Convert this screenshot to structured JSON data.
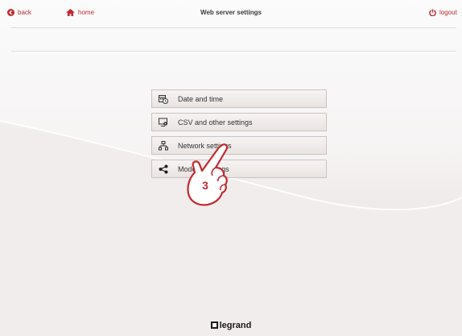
{
  "nav": {
    "back_label": "back",
    "home_label": "home",
    "title": "Web server settings",
    "logout_label": "logout"
  },
  "menu": {
    "items": [
      {
        "label": "Date and time",
        "icon": "calendar-clock-icon"
      },
      {
        "label": "CSV and other settings",
        "icon": "monitor-gear-icon"
      },
      {
        "label": "Network settings",
        "icon": "network-icon"
      },
      {
        "label": "Modem settings",
        "icon": "share-icon"
      }
    ]
  },
  "callout": {
    "step": "3"
  },
  "brand": {
    "logo_text": "legrand"
  },
  "colors": {
    "accent": "#c02a32",
    "step_hand_fill": "#ffffff"
  }
}
